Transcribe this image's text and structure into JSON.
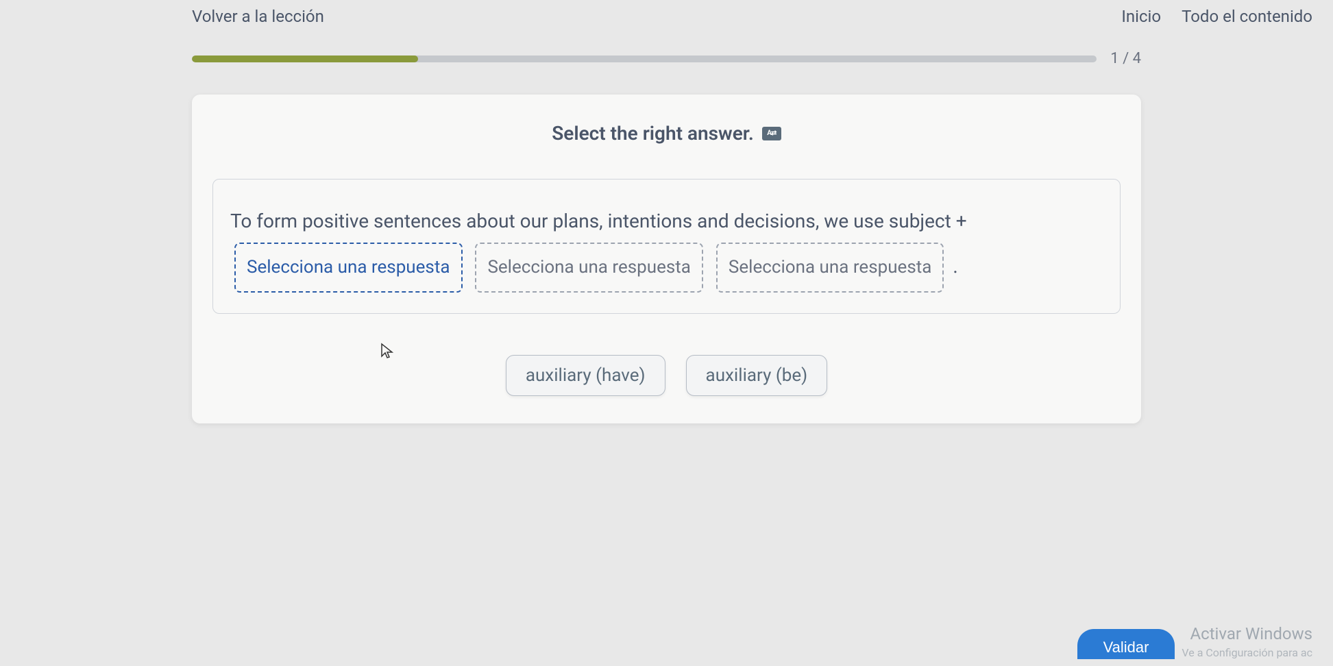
{
  "header": {
    "back_label": "Volver a la lección",
    "nav": {
      "inicio": "Inicio",
      "todo": "Todo el contenido"
    }
  },
  "progress": {
    "text": "1 / 4"
  },
  "instruction": "Select the right answer.",
  "question": {
    "text_before": "To form positive sentences about our plans, intentions and decisions, we use subject + ",
    "slot1_placeholder": "Selecciona una respuesta",
    "slot2_placeholder": "Selecciona una respuesta",
    "slot3_placeholder": "Selecciona una respuesta",
    "text_end": " ."
  },
  "answers": {
    "option1": "auxiliary (have)",
    "option2": "auxiliary (be)"
  },
  "footer": {
    "validate": "Validar",
    "watermark_title": "Activar Windows",
    "watermark_sub": "Ve a Configuración para ac"
  },
  "translate_icon_label": "A⇄"
}
